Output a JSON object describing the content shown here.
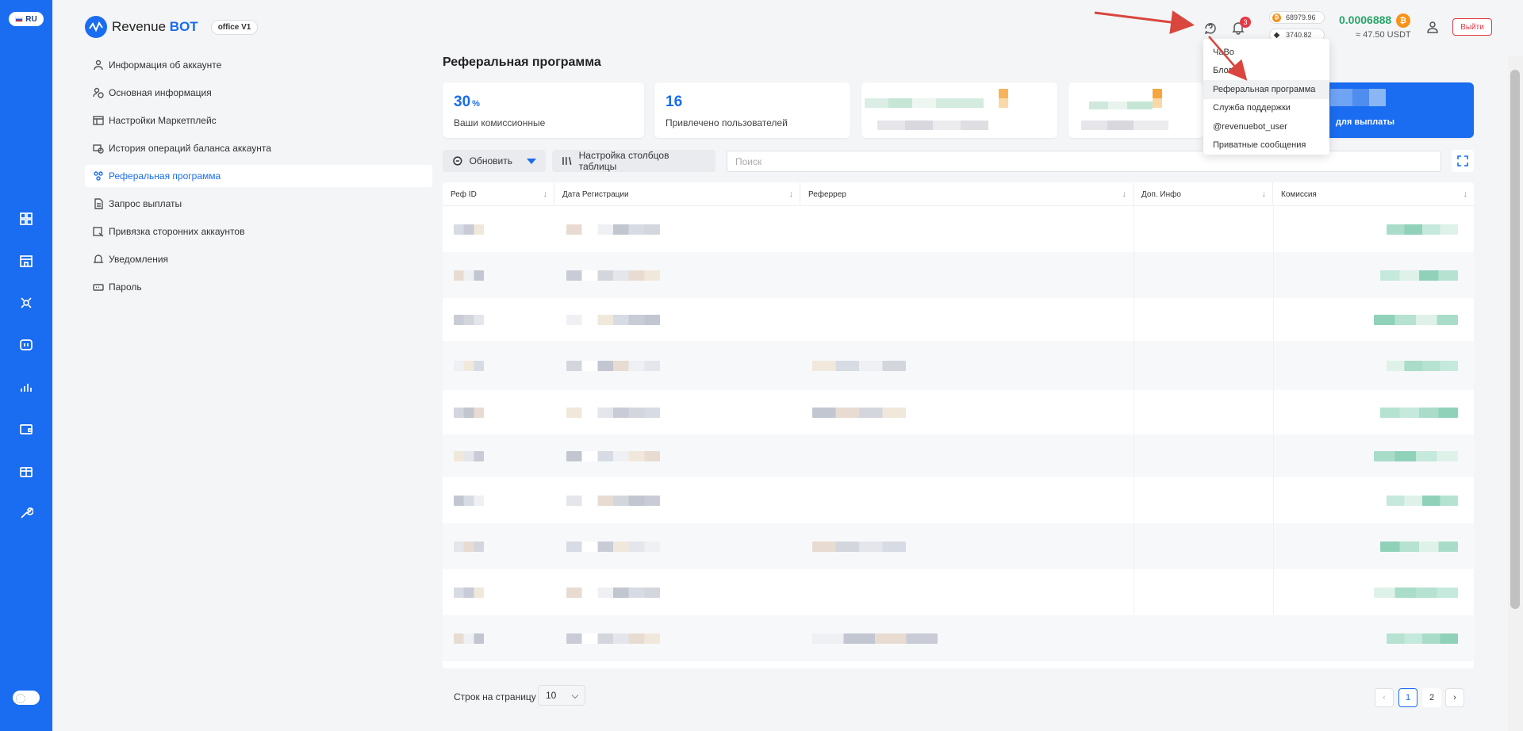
{
  "lang": "RU",
  "brand": {
    "name_regular": "Revenue",
    "name_bold": "BOT",
    "office": "office V1",
    "accent": "#1a6cf0"
  },
  "header": {
    "notifications_count": "3",
    "btc_price": "68979.96",
    "eth_price": "3740.82",
    "balance": "0.0006888",
    "balance_usdt": "≈ 47.50 USDT",
    "logout": "Выйти",
    "btc_symbol": "₿"
  },
  "side_menu": [
    {
      "label": "Информация об аккаунте",
      "icon": "user-icon"
    },
    {
      "label": "Основная информация",
      "icon": "user-clock-icon"
    },
    {
      "label": "Настройки Маркетплейс",
      "icon": "settings-grid-icon"
    },
    {
      "label": "История операций баланса аккаунта",
      "icon": "history-icon"
    },
    {
      "label": "Реферальная программа",
      "icon": "referral-icon",
      "active": true
    },
    {
      "label": "Запрос выплаты",
      "icon": "document-icon"
    },
    {
      "label": "Привязка сторонних аккаунтов",
      "icon": "link-account-icon"
    },
    {
      "label": "Уведомления",
      "icon": "bell-icon"
    },
    {
      "label": "Пароль",
      "icon": "password-icon"
    }
  ],
  "page": {
    "title": "Реферальная программа",
    "cards": {
      "commission_value": "30",
      "commission_unit": "%",
      "commission_label": "Ваши комиссионные",
      "referred_value": "16",
      "referred_label": "Привлечено пользователей",
      "payout_label": "для выплаты"
    },
    "toolbar": {
      "refresh": "Обновить",
      "columns": "Настройка столбцов таблицы",
      "search_placeholder": "Поиск"
    },
    "table": {
      "columns": [
        "Реф ID",
        "Дата Регистрации",
        "Реферрер",
        "Доп. Инфо",
        "Комиссия"
      ]
    },
    "footer": {
      "rows_label": "Строк на страницу",
      "rows_value": "10",
      "page_1": "1",
      "page_2": "2"
    }
  },
  "help_menu": {
    "items": [
      "ЧаВо",
      "Блог",
      "Реферальная программа",
      "Служба поддержки",
      "@revenuebot_user",
      "Приватные сообщения"
    ]
  }
}
